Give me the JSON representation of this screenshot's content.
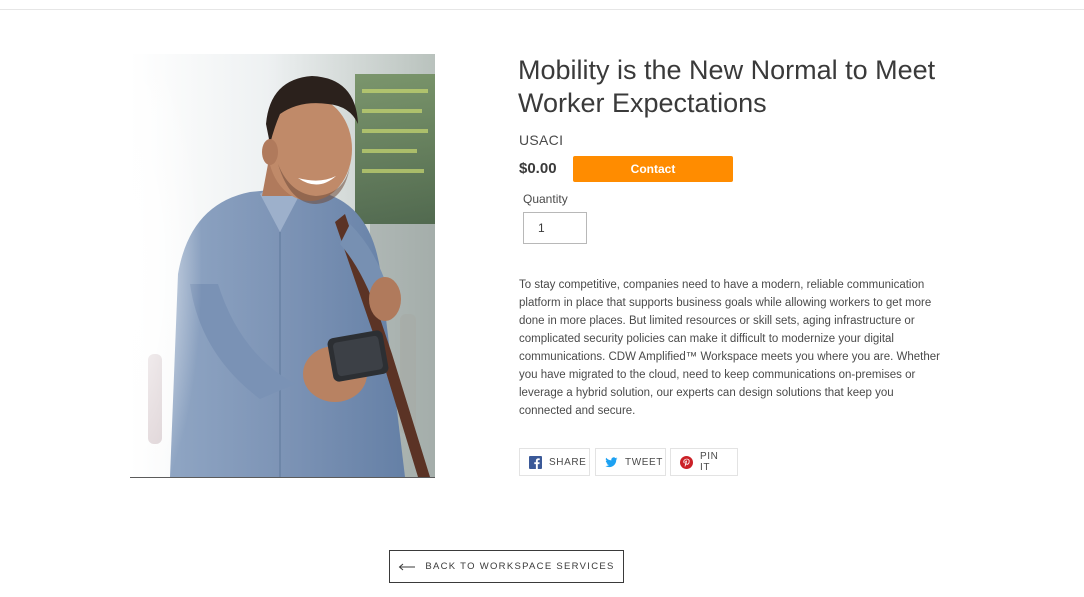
{
  "product": {
    "title": "Mobility is the New Normal to Meet Worker Expectations",
    "vendor": "USACI",
    "price": "$0.00",
    "contact_label": "Contact",
    "quantity_label": "Quantity",
    "quantity_value": "1",
    "description": "To stay competitive, companies need to have a modern, reliable communication platform in place that supports business goals while allowing workers to get more done in more places. But limited resources or skill sets, aging infrastructure or complicated security policies can make it difficult to modernize your digital communications. CDW Amplified™ Workspace meets you where you are. Whether you have migrated to the cloud, need to keep communications on-premises or leverage a hybrid solution, our experts can design solutions that keep you connected and secure."
  },
  "share": {
    "facebook_label": "SHARE",
    "twitter_label": "TWEET",
    "pinterest_label": "PIN IT"
  },
  "navigation": {
    "back_label": "BACK TO WORKSPACE SERVICES"
  },
  "colors": {
    "accent": "#ff8c00",
    "facebook": "#3b5998",
    "twitter": "#1da1f2",
    "pinterest": "#cb2027"
  },
  "icons": {
    "facebook": "facebook-icon",
    "twitter": "twitter-icon",
    "pinterest": "pinterest-icon",
    "back": "arrow-left-icon"
  }
}
